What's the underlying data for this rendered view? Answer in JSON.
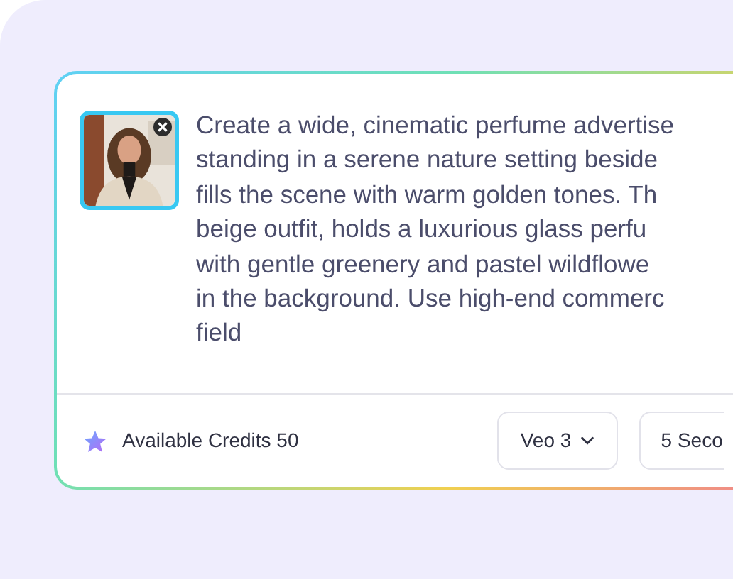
{
  "prompt": {
    "lines": [
      "Create a wide, cinematic perfume advertise",
      "standing in a serene nature setting beside",
      "fills the scene with warm golden tones. Th",
      "beige outfit, holds a luxurious glass perfu",
      "with gentle greenery and pastel wildflowe",
      "in the background. Use high-end commerc",
      "field"
    ]
  },
  "footer": {
    "credits": "Available Credits 50",
    "model": "Veo 3",
    "duration": "5 Seco"
  }
}
